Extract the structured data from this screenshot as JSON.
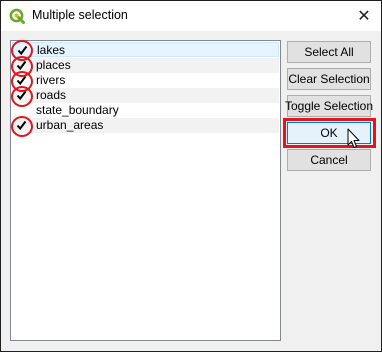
{
  "window": {
    "title": "Multiple selection",
    "app_icon": "qgis-logo-icon",
    "close_glyph": "✕"
  },
  "list": {
    "items": [
      {
        "label": "lakes",
        "checked": true
      },
      {
        "label": "places",
        "checked": true
      },
      {
        "label": "rivers",
        "checked": true
      },
      {
        "label": "roads",
        "checked": true
      },
      {
        "label": "state_boundary",
        "checked": false
      },
      {
        "label": "urban_areas",
        "checked": true
      }
    ]
  },
  "buttons": {
    "select_all": "Select All",
    "clear_selection": "Clear Selection",
    "toggle_selection": "Toggle Selection",
    "ok": "OK",
    "cancel": "Cancel"
  },
  "colors": {
    "annotation_red": "#e3141c",
    "accent": "#0078d7"
  }
}
